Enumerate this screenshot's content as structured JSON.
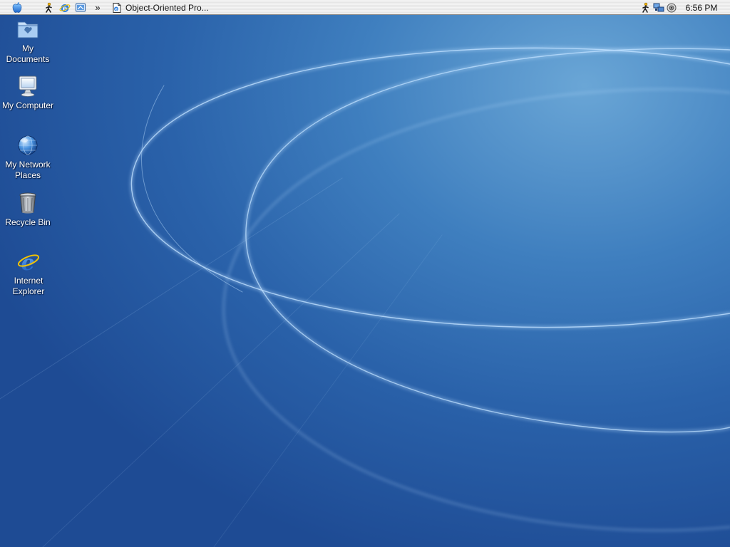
{
  "menubar": {
    "apple_icon": "apple-logo-icon",
    "quick_launch": [
      {
        "icon": "aim-running-man-icon"
      },
      {
        "icon": "internet-explorer-icon"
      },
      {
        "icon": "show-desktop-icon"
      }
    ],
    "overflow_label": "»",
    "active_task": {
      "icon": "document-icon",
      "label": "Object-Oriented Pro..."
    },
    "tray": [
      {
        "icon": "aim-tray-icon"
      },
      {
        "icon": "network-icon"
      },
      {
        "icon": "volume-icon"
      }
    ],
    "clock": "6:56 PM"
  },
  "desktop": {
    "icons": [
      {
        "id": "my-documents",
        "label_lines": [
          "My",
          "Documents"
        ]
      },
      {
        "id": "my-computer",
        "label_lines": [
          "My Computer"
        ]
      },
      {
        "id": "my-network-places",
        "label_lines": [
          "My Network",
          "Places"
        ]
      },
      {
        "id": "recycle-bin",
        "label_lines": [
          "Recycle Bin"
        ]
      },
      {
        "id": "internet-explorer",
        "label_lines": [
          "Internet",
          "Explorer"
        ]
      }
    ]
  },
  "colors": {
    "wallpaper_light": "#6aa6d6",
    "wallpaper_mid": "#3f7fbf",
    "wallpaper_dark": "#1e4b94",
    "menubar_bg": "#e9e9e9",
    "label_text": "#ffffff"
  }
}
